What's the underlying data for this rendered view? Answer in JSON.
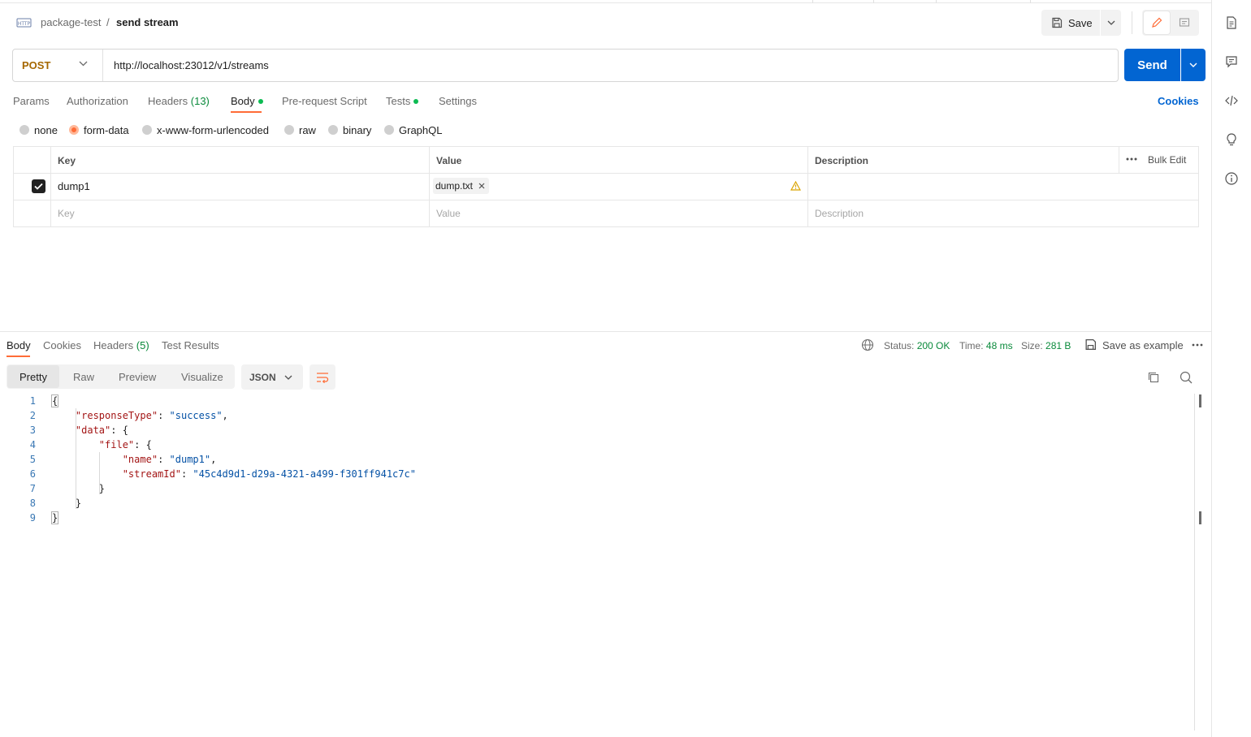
{
  "header": {
    "icon": "http-icon",
    "breadcrumb_parent": "package-test",
    "breadcrumb_sep": "/",
    "breadcrumb_current": "send stream",
    "save_label": "Save"
  },
  "request": {
    "method": "POST",
    "url": "http://localhost:23012/v1/streams",
    "send_label": "Send",
    "tabs": [
      {
        "label": "Params"
      },
      {
        "label": "Authorization"
      },
      {
        "label": "Headers",
        "count": "(13)"
      },
      {
        "label": "Body",
        "indicator": true,
        "active": true
      },
      {
        "label": "Pre-request Script"
      },
      {
        "label": "Tests",
        "indicator": true
      },
      {
        "label": "Settings"
      }
    ],
    "cookies_link": "Cookies",
    "body_types": [
      "none",
      "form-data",
      "x-www-form-urlencoded",
      "raw",
      "binary",
      "GraphQL"
    ],
    "selected_body_type": "form-data"
  },
  "form_table": {
    "headers": {
      "key": "Key",
      "value": "Value",
      "description": "Description"
    },
    "bulk_edit": "Bulk Edit",
    "rows": [
      {
        "checked": true,
        "key": "dump1",
        "file_chip": "dump.txt",
        "description": ""
      }
    ],
    "placeholder": {
      "key": "Key",
      "value": "Value",
      "description": "Description"
    }
  },
  "response": {
    "tabs": [
      {
        "label": "Body",
        "active": true
      },
      {
        "label": "Cookies"
      },
      {
        "label": "Headers",
        "count": "(5)"
      },
      {
        "label": "Test Results"
      }
    ],
    "status_label": "Status:",
    "status_value": "200 OK",
    "time_label": "Time:",
    "time_value": "48 ms",
    "size_label": "Size:",
    "size_value": "281 B",
    "save_example": "Save as example",
    "view_modes": [
      "Pretty",
      "Raw",
      "Preview",
      "Visualize"
    ],
    "active_view": "Pretty",
    "format": "JSON",
    "line_numbers": [
      "1",
      "2",
      "3",
      "4",
      "5",
      "6",
      "7",
      "8",
      "9"
    ],
    "json": {
      "responseType_key": "\"responseType\"",
      "responseType_val": "\"success\"",
      "data_key": "\"data\"",
      "file_key": "\"file\"",
      "name_key": "\"name\"",
      "name_val": "\"dump1\"",
      "streamId_key": "\"streamId\"",
      "streamId_val": "\"45c4d9d1-d29a-4321-a499-f301ff941c7c\""
    }
  },
  "colors": {
    "accent": "#ff6c37",
    "send": "#0265d2",
    "success": "#0a8a3b",
    "method_post": "#a56700"
  }
}
